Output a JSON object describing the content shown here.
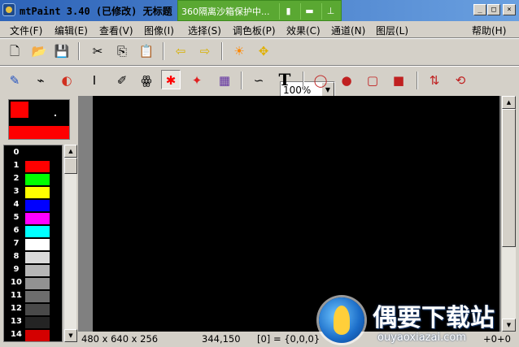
{
  "window": {
    "title": "mtPaint 3.40 (已修改) 无标题",
    "buttons": {
      "minimize": "_",
      "maximize": "□",
      "close": "×"
    }
  },
  "sandbox_bar": {
    "text": "360隔离沙箱保护中...",
    "icons": [
      "sandbox-clip-icon",
      "folder-icon",
      "pin-icon"
    ],
    "color": "#5aa832"
  },
  "menu": {
    "items": [
      "文件(F)",
      "编辑(E)",
      "查看(V)",
      "图像(I)",
      "选择(S)",
      "调色板(P)",
      "效果(C)",
      "通道(N)",
      "图层(L)"
    ],
    "help": "帮助(H)"
  },
  "toolbar1": {
    "zoom": "100%"
  },
  "toolbar2": {
    "active_tool": "brush-select"
  },
  "palette": {
    "entries": [
      {
        "index": "0",
        "color": "#000000"
      },
      {
        "index": "1",
        "color": "#ff0000"
      },
      {
        "index": "2",
        "color": "#00ff00"
      },
      {
        "index": "3",
        "color": "#ffff00"
      },
      {
        "index": "4",
        "color": "#0000ff"
      },
      {
        "index": "5",
        "color": "#ff00ff"
      },
      {
        "index": "6",
        "color": "#00ffff"
      },
      {
        "index": "7",
        "color": "#ffffff"
      },
      {
        "index": "8",
        "color": "#dadada"
      },
      {
        "index": "9",
        "color": "#b6b6b6"
      },
      {
        "index": "10",
        "color": "#929292"
      },
      {
        "index": "11",
        "color": "#6d6d6d"
      },
      {
        "index": "12",
        "color": "#494949"
      },
      {
        "index": "13",
        "color": "#242424"
      },
      {
        "index": "14",
        "color": "#d40000"
      }
    ],
    "foreground": "#ff0000",
    "background": "#ff0000"
  },
  "canvas": {
    "background": "#000000"
  },
  "status": {
    "size": "480 x 640 x 256",
    "coords": "344,150",
    "pixel": "[0] = {0,0,0}",
    "extra": "+0+0"
  },
  "watermark": {
    "title": "偶要下载站",
    "url": "ouyaoxiazai.com"
  }
}
